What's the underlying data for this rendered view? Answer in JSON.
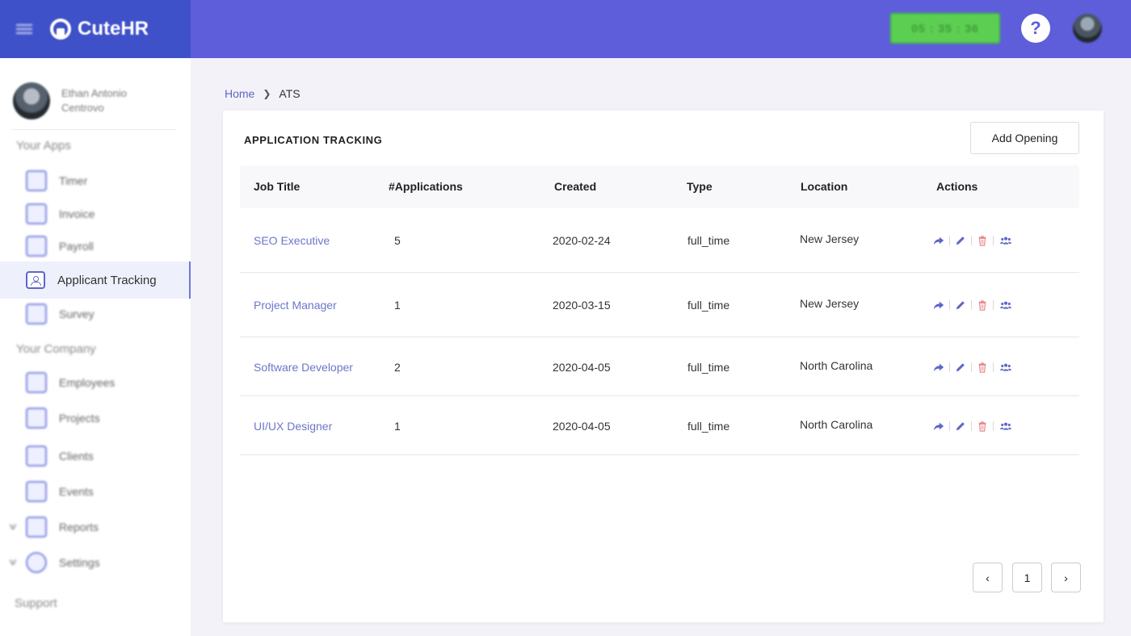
{
  "app": {
    "name": "CuteHR"
  },
  "topbar": {
    "timer": "05 : 35 : 36",
    "help_label": "?"
  },
  "sidebar": {
    "user_name": "Ethan Antonio Centrovo",
    "your_apps_title": "Your Apps",
    "apps": [
      {
        "label": "Timer",
        "icon": "timer-icon"
      },
      {
        "label": "Invoice",
        "icon": "invoice-icon"
      },
      {
        "label": "Payroll",
        "icon": "payroll-icon"
      },
      {
        "label": "Applicant Tracking",
        "icon": "applicant-tracking-icon",
        "active": true
      },
      {
        "label": "Survey",
        "icon": "survey-icon"
      }
    ],
    "your_company_title": "Your Company",
    "company": [
      {
        "label": "Employees",
        "icon": "employees-icon"
      },
      {
        "label": "Projects",
        "icon": "projects-icon"
      },
      {
        "label": "Clients",
        "icon": "clients-icon"
      },
      {
        "label": "Events",
        "icon": "events-icon"
      },
      {
        "label": "Reports",
        "icon": "reports-icon",
        "expandable": true
      },
      {
        "label": "Settings",
        "icon": "settings-icon",
        "expandable": true
      }
    ],
    "support_label": "Support"
  },
  "breadcrumb": {
    "home": "Home",
    "current": "ATS"
  },
  "main": {
    "title": "APPLICATION TRACKING",
    "add_button": "Add Opening",
    "columns": [
      "Job Title",
      "#Applications",
      "Created",
      "Type",
      "Location",
      "Actions"
    ],
    "rows": [
      {
        "job_title": "SEO Executive",
        "applications": "5",
        "created": "2020-02-24",
        "type": "full_time",
        "location": "New Jersey"
      },
      {
        "job_title": "Project Manager",
        "applications": "1",
        "created": "2020-03-15",
        "type": "full_time",
        "location": "New Jersey"
      },
      {
        "job_title": "Software Developer",
        "applications": "2",
        "created": "2020-04-05",
        "type": "full_time",
        "location": "North Carolina"
      },
      {
        "job_title": "UI/UX Designer",
        "applications": "1",
        "created": "2020-04-05",
        "type": "full_time",
        "location": "North Carolina"
      }
    ],
    "pagination": {
      "prev": "‹",
      "page": "1",
      "next": "›"
    }
  },
  "colors": {
    "brand": "#3f51c9",
    "topbar": "#5e5edb",
    "link": "#6c76c9",
    "delete": "#e88a8a",
    "timer": "#5ccf52"
  }
}
